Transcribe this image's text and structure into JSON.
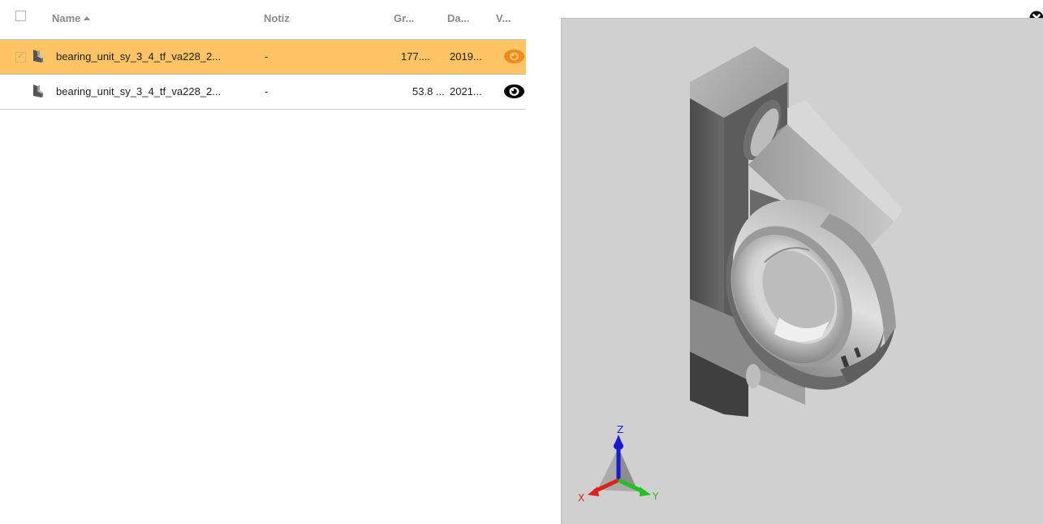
{
  "table": {
    "columns": {
      "name": "Name",
      "note": "Notiz",
      "size": "Gr...",
      "date": "Da...",
      "view": "V..."
    },
    "rows": [
      {
        "selected": true,
        "checked": true,
        "name": "bearing_unit_sy_3_4_tf_va228_2...",
        "note": "-",
        "size": "177....",
        "date": "2019...",
        "view_icon": "eye-icon-active"
      },
      {
        "selected": false,
        "checked": false,
        "name": "bearing_unit_sy_3_4_tf_va228_2...",
        "note": "-",
        "size": "53.8 ...",
        "date": "2021...",
        "view_icon": "eye-icon"
      }
    ]
  },
  "viewer": {
    "axes": {
      "x": "X",
      "y": "Y",
      "z": "Z"
    }
  },
  "colors": {
    "selected_row": "#ffc466",
    "accent_orange": "#f08a1c",
    "viewer_bg": "#d0d0d0",
    "axis_x": "#e0201a",
    "axis_y": "#22c022",
    "axis_z": "#1a1ad0"
  }
}
